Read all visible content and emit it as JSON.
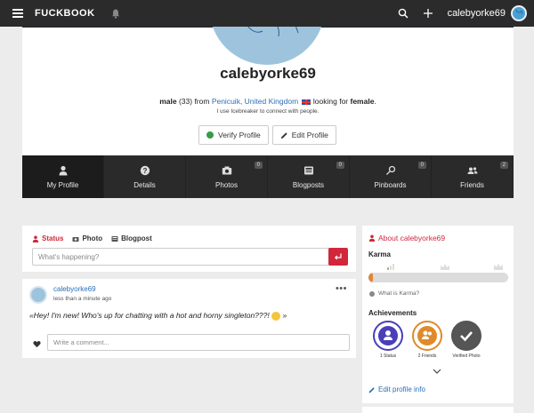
{
  "topbar": {
    "logo": "FUCKBOOK",
    "username": "calebyorke69"
  },
  "profile": {
    "name": "calebyorke69",
    "gender": "male",
    "age": "(33)",
    "from_label": "from",
    "location": "Penicuik, United Kingdom",
    "looking_label": "looking for",
    "looking_for": "female",
    "icebreaker": "I use Icebreaker to connect with people.",
    "verify_label": "Verify Profile",
    "edit_label": "Edit Profile"
  },
  "tabs": [
    {
      "label": "My Profile",
      "icon": "user-icon",
      "badge": ""
    },
    {
      "label": "Details",
      "icon": "question-icon",
      "badge": ""
    },
    {
      "label": "Photos",
      "icon": "camera-icon",
      "badge": "0"
    },
    {
      "label": "Blogposts",
      "icon": "newspaper-icon",
      "badge": "0"
    },
    {
      "label": "Pinboards",
      "icon": "pin-icon",
      "badge": "0"
    },
    {
      "label": "Friends",
      "icon": "friends-icon",
      "badge": "2"
    }
  ],
  "composer": {
    "tabs": [
      "Status",
      "Photo",
      "Blogpost"
    ],
    "placeholder": "What's happening?"
  },
  "post": {
    "author": "calebyorke69",
    "time": "less than a minute ago",
    "text": "«Hey! I'm new! Who's up for chatting with a hot and horny singleton???!",
    "text_end": "»",
    "comment_placeholder": "Write a comment..."
  },
  "about": {
    "title": "About calebyorke69",
    "karma_label": "Karma",
    "karma_fraction": 0.03,
    "karma_link": "What is Karma?",
    "achievements_label": "Achievements",
    "achievements": [
      {
        "label": "1 Status",
        "color": "#4a3fb8"
      },
      {
        "label": "2 Friends",
        "color": "#e08a2a"
      },
      {
        "label": "Verified Photo",
        "color": "#555555"
      }
    ],
    "edit_info": "Edit profile info"
  },
  "colors": {
    "accent": "#d0283a",
    "link": "#2a6fb8",
    "topbar": "#2b2b2b"
  }
}
